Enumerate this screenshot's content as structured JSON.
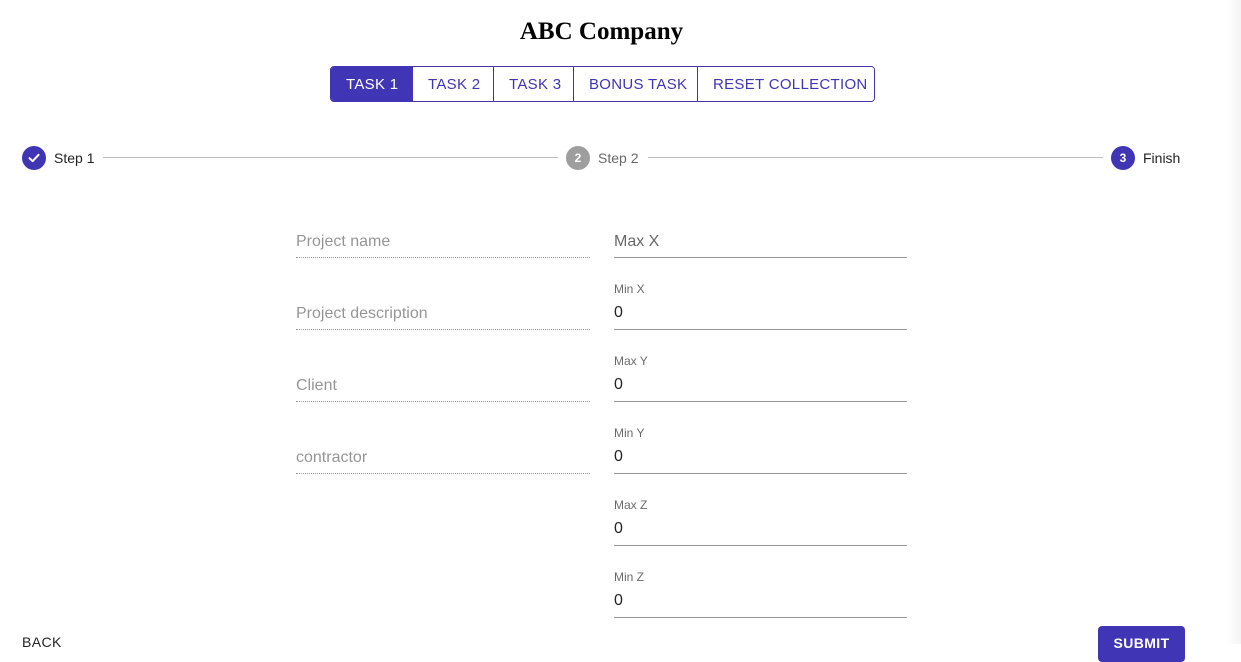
{
  "page": {
    "title": "ABC Company"
  },
  "tabs": [
    {
      "label": "TASK 1",
      "active": true
    },
    {
      "label": "TASK 2",
      "active": false
    },
    {
      "label": "TASK 3",
      "active": false
    },
    {
      "label": "BONUS TASK",
      "active": false
    },
    {
      "label": "RESET COLLECTION",
      "active": false
    }
  ],
  "stepper": {
    "steps": [
      {
        "label": "Step 1",
        "state": "completed",
        "icon": "check-icon"
      },
      {
        "label": "Step 2",
        "state": "inactive",
        "number": "2"
      },
      {
        "label": "Finish",
        "state": "active",
        "number": "3"
      }
    ]
  },
  "form": {
    "left": {
      "project_name": {
        "placeholder": "Project name",
        "value": ""
      },
      "project_description": {
        "placeholder": "Project description",
        "value": ""
      },
      "client": {
        "placeholder": "Client",
        "value": ""
      },
      "contractor": {
        "placeholder": "contractor",
        "value": ""
      }
    },
    "right": {
      "max_x": {
        "placeholder": "Max X",
        "value": ""
      },
      "min_x": {
        "label": "Min X",
        "value": "0"
      },
      "max_y": {
        "label": "Max Y",
        "value": "0"
      },
      "min_y": {
        "label": "Min Y",
        "value": "0"
      },
      "max_z": {
        "label": "Max Z",
        "value": "0"
      },
      "min_z": {
        "label": "Min Z",
        "value": "0"
      }
    }
  },
  "actions": {
    "back_label": "BACK",
    "submit_label": "SUBMIT"
  },
  "colors": {
    "primary": "#3f35b5",
    "inactive_step": "#9e9e9e"
  }
}
